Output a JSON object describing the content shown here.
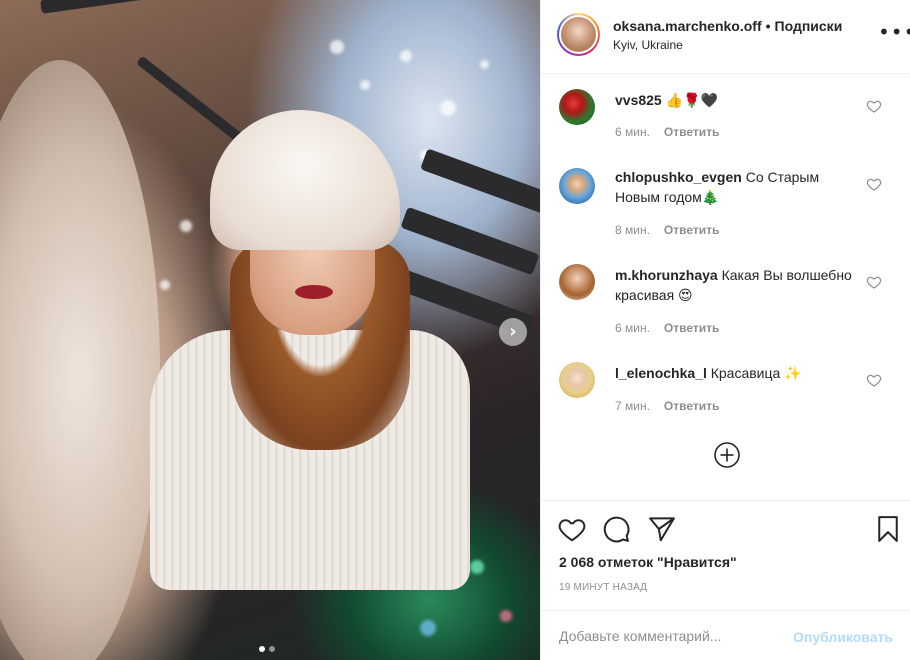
{
  "post": {
    "username": "oksana.marchenko.off",
    "separator": "•",
    "follow_label": "Подписки",
    "location": "Kyiv, Ukraine",
    "more_icon": "more-horizontal-icon",
    "carousel": {
      "current": 1,
      "total": 2
    }
  },
  "comments": [
    {
      "user": "vvs825",
      "text": "👍🌹🖤",
      "time": "6 мин.",
      "reply": "Ответить",
      "avatar": "roses-avatar"
    },
    {
      "user": "chlopushko_evgen",
      "text": "Со Старым Новым годом🎄",
      "time": "8 мин.",
      "reply": "Ответить",
      "avatar": "child-avatar"
    },
    {
      "user": "m.khorunzhaya",
      "text": "Какая Вы волшебно красивая 😍",
      "time": "6 мин.",
      "reply": "Ответить",
      "avatar": "woman-avatar"
    },
    {
      "user": "l_elenochka_l",
      "text": "Красавица ✨",
      "time": "7 мин.",
      "reply": "Ответить",
      "avatar": "blonde-avatar"
    }
  ],
  "actions": {
    "like_icon": "heart-icon",
    "comment_icon": "comment-icon",
    "share_icon": "share-icon",
    "save_icon": "bookmark-icon",
    "likes_text": "2 068 отметок \"Нравится\"",
    "timestamp": "19 МИНУТ НАЗАД"
  },
  "add_comment": {
    "placeholder": "Добавьте комментарий...",
    "publish_label": "Опубликовать"
  },
  "colors": {
    "text": "#262626",
    "secondary": "#8e8e8e",
    "publish_disabled": "#b3dbff",
    "border": "#efefef"
  }
}
